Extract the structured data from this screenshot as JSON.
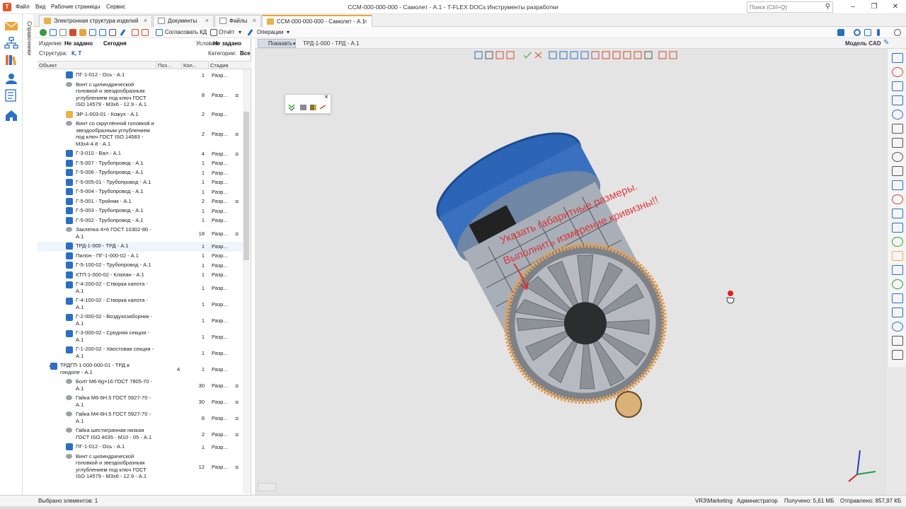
{
  "window": {
    "title": "CCM-000-000-000 - Самолет - А.1 - T-FLEX DOCs Инструменты разработки",
    "menu": [
      "Файл",
      "Вид",
      "Рабочие страницы",
      "Сервис"
    ],
    "search_placeholder": "Поиск (Ctrl+Q)",
    "controls": [
      "–",
      "❐",
      "✕"
    ]
  },
  "sidebar": {
    "vertical_label": "Справочники"
  },
  "tabs": [
    {
      "label": "Электронная структура изделий",
      "active": false
    },
    {
      "label": "Документы",
      "active": false
    },
    {
      "label": "Файлы",
      "active": false
    },
    {
      "label": "ССМ-000-000-000 - Самолет - А.1",
      "active": true
    }
  ],
  "toolbar": {
    "approve_label": "Согласовать КД",
    "report_label": "Отчёт",
    "operations_label": "Операции"
  },
  "filters": {
    "product_label": "Изделие:",
    "product_value": "Не задано",
    "date_value": "Сегодня",
    "conditions_label": "Условия:",
    "conditions_value": "Не задано",
    "structure_label": "Структура:",
    "structure_value": "К, Т",
    "categories_label": "Категории:",
    "categories_value": "Все"
  },
  "grid": {
    "headers": [
      "Объект",
      "Поз...",
      "Кол...",
      "Стадия"
    ],
    "rows": [
      {
        "name": "ПГ-1-012 - Ось - А.1",
        "pos": "",
        "qty": "1",
        "stage": "Разр...",
        "doc": "",
        "kind": "asm",
        "level": 2
      },
      {
        "name": "Винт с цилиндрической головкой и звездообразным углублением под ключ ГОСТ ISO 14579 - М3х6 - 12.9 - А.1",
        "pos": "",
        "qty": "8",
        "stage": "Разр...",
        "doc": "≡",
        "kind": "std",
        "level": 2
      },
      {
        "name": "ЭР-1-003-01 - Кожух - А.1",
        "pos": "",
        "qty": "2",
        "stage": "Разр...",
        "doc": "",
        "kind": "part",
        "level": 2
      },
      {
        "name": "Винт со скруглённой головкой и звездообразным углублением под ключ ГОСТ ISO 14583 - М3х4-4.8 - А.1",
        "pos": "",
        "qty": "2",
        "stage": "Разр...",
        "doc": "≡",
        "kind": "std",
        "level": 2
      },
      {
        "name": "Г-3-010 - Вал - А.1",
        "pos": "",
        "qty": "4",
        "stage": "Разр...",
        "doc": "≡",
        "kind": "asm",
        "level": 2
      },
      {
        "name": "Г-5-007 - Трубопровод - А.1",
        "pos": "",
        "qty": "1",
        "stage": "Разр...",
        "doc": "",
        "kind": "asm",
        "level": 2
      },
      {
        "name": "Г-5-006 - Трубопровод - А.1",
        "pos": "",
        "qty": "1",
        "stage": "Разр...",
        "doc": "",
        "kind": "asm",
        "level": 2
      },
      {
        "name": "Г-5-005-01 - Трубопровод - А.1",
        "pos": "",
        "qty": "1",
        "stage": "Разр...",
        "doc": "",
        "kind": "asm",
        "level": 2
      },
      {
        "name": "Г-5-004 - Трубопровод - А.1",
        "pos": "",
        "qty": "1",
        "stage": "Разр...",
        "doc": "",
        "kind": "asm",
        "level": 2
      },
      {
        "name": "Г-5-001 - Тройник - А.1",
        "pos": "",
        "qty": "2",
        "stage": "Разр...",
        "doc": "≡",
        "kind": "asm",
        "level": 2
      },
      {
        "name": "Г-5-003 - Трубопровод - А.1",
        "pos": "",
        "qty": "1",
        "stage": "Разр...",
        "doc": "",
        "kind": "asm",
        "level": 2
      },
      {
        "name": "Г-5-002 - Трубопровод - А.1",
        "pos": "",
        "qty": "1",
        "stage": "Разр...",
        "doc": "",
        "kind": "asm",
        "level": 2
      },
      {
        "name": "Заклепка 4×6 ГОСТ 10302-80 - А.1",
        "pos": "",
        "qty": "18",
        "stage": "Разр...",
        "doc": "≡",
        "kind": "std",
        "level": 2
      },
      {
        "name": "ТРД-1-000 - ТРД - А.1",
        "pos": "",
        "qty": "1",
        "stage": "Разр...",
        "doc": "",
        "kind": "asm2",
        "level": 2,
        "selected": true
      },
      {
        "name": "Пилон - ПГ-1-000-02 - А.1",
        "pos": "",
        "qty": "1",
        "stage": "Разр...",
        "doc": "",
        "kind": "asm2",
        "level": 2
      },
      {
        "name": "Г-5-100-02 - Трубопровод - А.1",
        "pos": "",
        "qty": "1",
        "stage": "Разр...",
        "doc": "",
        "kind": "asm2",
        "level": 2
      },
      {
        "name": "КТП-1-000-02 - Клапан - А.1",
        "pos": "",
        "qty": "1",
        "stage": "Разр...",
        "doc": "",
        "kind": "asm2",
        "level": 2
      },
      {
        "name": "Г-4-200-02 - Створка капота - А.1",
        "pos": "",
        "qty": "1",
        "stage": "Разр...",
        "doc": "",
        "kind": "asm2",
        "level": 2
      },
      {
        "name": "Г-4-100-02 - Створка капота - А.1",
        "pos": "",
        "qty": "1",
        "stage": "Разр...",
        "doc": "",
        "kind": "asm2",
        "level": 2
      },
      {
        "name": "Г-2-000-02 - Воздухозаборник - А.1",
        "pos": "",
        "qty": "1",
        "stage": "Разр...",
        "doc": "",
        "kind": "asm2",
        "level": 2
      },
      {
        "name": "Г-3-000-02 - Средняя секция - А.1",
        "pos": "",
        "qty": "1",
        "stage": "Разр...",
        "doc": "",
        "kind": "asm2",
        "level": 2
      },
      {
        "name": "Г-1-200-02 - Хвостовая секция - А.1",
        "pos": "",
        "qty": "1",
        "stage": "Разр...",
        "doc": "",
        "kind": "asm2",
        "level": 2
      },
      {
        "name": "ТРДГП-1-000-000-01 - ТРД в гондоле - А.1",
        "pos": "4",
        "qty": "1",
        "stage": "Разр...",
        "doc": "",
        "kind": "asm2",
        "level": 1
      },
      {
        "name": "Болт М6-6g×16 ГОСТ 7805-70 - А.1",
        "pos": "",
        "qty": "30",
        "stage": "Разр...",
        "doc": "≡",
        "kind": "std",
        "level": 2
      },
      {
        "name": "Гайка М6-6Н.5 ГОСТ 5927-70 - А.1",
        "pos": "",
        "qty": "30",
        "stage": "Разр...",
        "doc": "≡",
        "kind": "std",
        "level": 2
      },
      {
        "name": "Гайка М4-6Н.5 ГОСТ 5927-70 - А.1",
        "pos": "",
        "qty": "8",
        "stage": "Разр...",
        "doc": "≡",
        "kind": "std",
        "level": 2
      },
      {
        "name": "Гайка шестигранная низкая ГОСТ ISO 4035 - М10 - 05 - А.1",
        "pos": "",
        "qty": "2",
        "stage": "Разр...",
        "doc": "≡",
        "kind": "std",
        "level": 2
      },
      {
        "name": "ПГ-1-012 - Ось - А.1",
        "pos": "",
        "qty": "1",
        "stage": "Разр...",
        "doc": "",
        "kind": "asm",
        "level": 2
      },
      {
        "name": "Винт с цилиндрической головкой и звездообразным углублением под ключ ГОСТ ISO 14579 - М3х6 - 12.9 - А.1",
        "pos": "",
        "qty": "12",
        "stage": "Разр...",
        "doc": "≡",
        "kind": "std",
        "level": 2
      }
    ]
  },
  "viewer": {
    "show_label": "Показать",
    "breadcrumb": "ТРД-1-000 - ТРД - А.1",
    "model_label": "Модель CAD",
    "annotation_1": "Указать габаритные размеры.",
    "annotation_2": "Выполнить измерение кривизны!!"
  },
  "colors": {
    "accent": "#e8a33b",
    "annot": "#e02020",
    "asm_icon": "#2a6fc4",
    "part_icon": "#e8b24a",
    "nacelle_blue": "#2c64b6",
    "ring_orange": "#e0a15a"
  },
  "status": {
    "selected": "Выбрано элементов: 1",
    "server": "VR3\\Marketing",
    "user": "Администратор",
    "received": "Получено: 5,61 МБ",
    "sent": "Отправлено: 857,97 КБ"
  }
}
